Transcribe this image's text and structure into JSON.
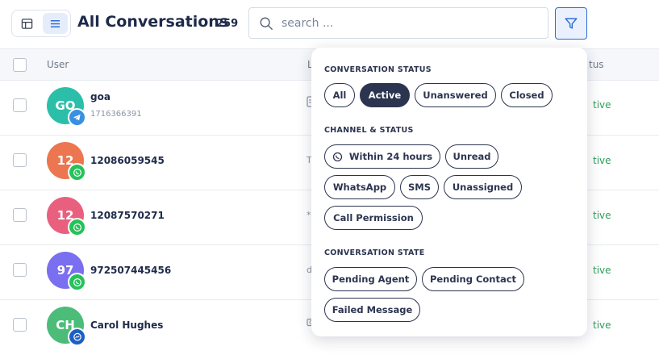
{
  "header": {
    "title": "All Conversations",
    "count": "259",
    "search_placeholder": "search ..."
  },
  "table": {
    "columns": [
      "User",
      "L",
      "tus"
    ],
    "rows": [
      {
        "initials": "GO",
        "name": "goa",
        "sub": "1716366391",
        "channel": "telegram",
        "avatar_color": "#2bbfa9",
        "last": "",
        "status": "tive"
      },
      {
        "initials": "12",
        "name": "12086059545",
        "sub": "",
        "channel": "whatsapp",
        "avatar_color": "#ec7650",
        "last": "T",
        "status": "tive"
      },
      {
        "initials": "12",
        "name": "12087570271",
        "sub": "",
        "channel": "whatsapp",
        "avatar_color": "#e9607f",
        "last": "*",
        "status": "tive"
      },
      {
        "initials": "97",
        "name": "972507445456",
        "sub": "",
        "channel": "whatsapp",
        "avatar_color": "#7a6ff0",
        "last": "d",
        "status": "tive"
      },
      {
        "initials": "CH",
        "name": "Carol Hughes",
        "sub": "",
        "channel": "messenger",
        "avatar_color": "#4cbc79",
        "last": "",
        "status": "tive"
      }
    ]
  },
  "filter_panel": {
    "sections": [
      {
        "title": "CONVERSATION STATUS",
        "chips": [
          {
            "label": "All",
            "selected": false
          },
          {
            "label": "Active",
            "selected": true
          },
          {
            "label": "Unanswered",
            "selected": false
          },
          {
            "label": "Closed",
            "selected": false
          }
        ]
      },
      {
        "title": "CHANNEL & STATUS",
        "chips": [
          {
            "label": "Within 24 hours",
            "selected": false,
            "icon": "whatsapp-icon"
          },
          {
            "label": "Unread",
            "selected": false
          },
          {
            "label": "WhatsApp",
            "selected": false
          },
          {
            "label": "SMS",
            "selected": false
          },
          {
            "label": "Unassigned",
            "selected": false
          },
          {
            "label": "Call Permission",
            "selected": false
          }
        ]
      },
      {
        "title": "CONVERSATION STATE",
        "chips": [
          {
            "label": "Pending Agent",
            "selected": false
          },
          {
            "label": "Pending Contact",
            "selected": false
          },
          {
            "label": "Failed Message",
            "selected": false
          }
        ]
      }
    ]
  },
  "colors": {
    "accent": "#2f6cd6",
    "chip_dark": "#2c3550",
    "status_green": "#2f9e5a",
    "whatsapp": "#25c25a"
  }
}
